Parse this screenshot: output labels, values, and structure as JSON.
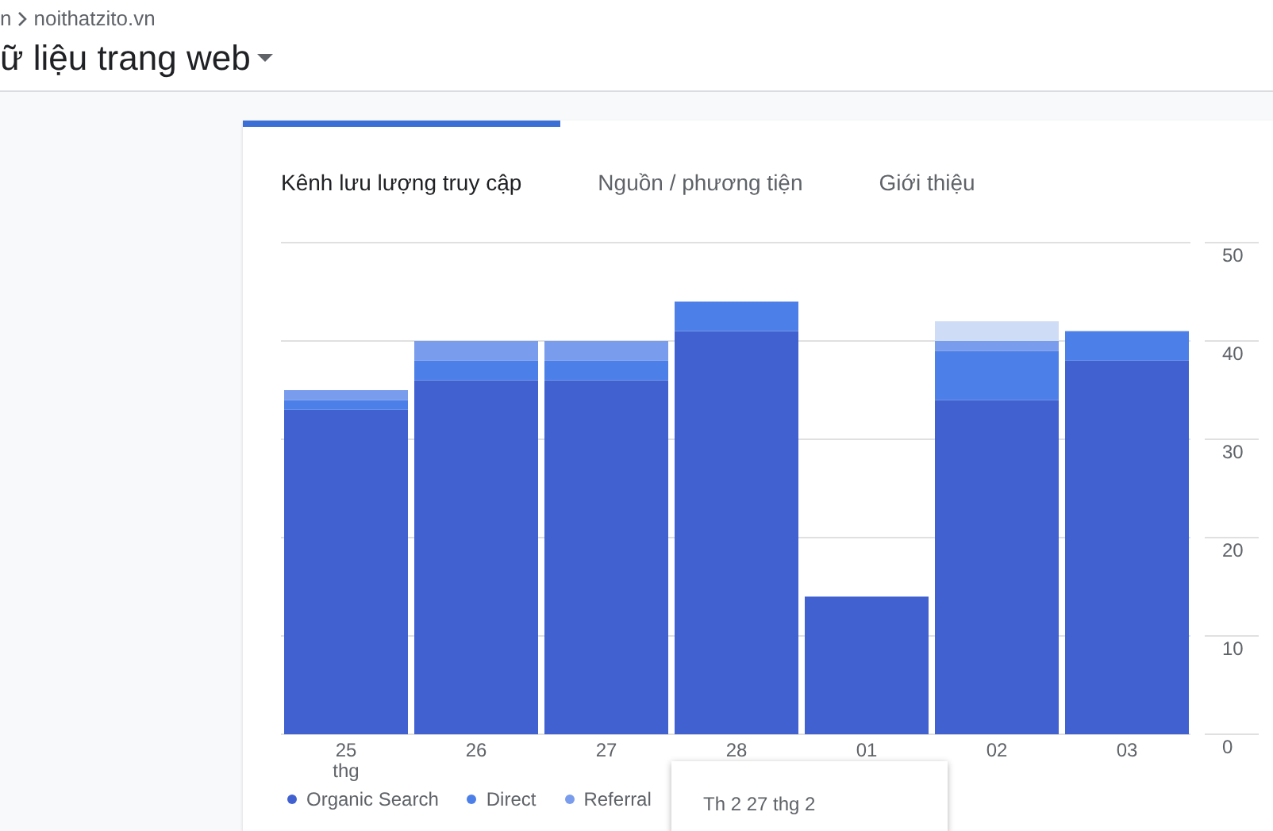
{
  "breadcrumb": [
    "n",
    "noithatzito.vn"
  ],
  "title": "ữ liệu trang web",
  "tabs": [
    {
      "label": "Kênh lưu lượng truy cập",
      "selected": true
    },
    {
      "label": "Nguồn / phương tiện",
      "selected": false
    },
    {
      "label": "Giới thiệu",
      "selected": false
    }
  ],
  "chart_data": {
    "type": "bar",
    "stacked": true,
    "grid": true,
    "categories": [
      "25 thg",
      "26",
      "27",
      "28",
      "01",
      "02",
      "03"
    ],
    "ylim": [
      0,
      50
    ],
    "yticks": [
      0,
      10,
      20,
      30,
      40,
      50
    ],
    "series": [
      {
        "name": "Organic Search",
        "color": "#4161d1",
        "values": [
          33,
          36,
          36,
          41,
          14,
          34,
          38
        ]
      },
      {
        "name": "Direct",
        "color": "#4d7fe8",
        "values": [
          1,
          2,
          2,
          3,
          0,
          5,
          3
        ]
      },
      {
        "name": "Referral",
        "color": "#7a9cec",
        "values": [
          1,
          2,
          2,
          0,
          0,
          1,
          0
        ]
      },
      {
        "color": "#cfdcf5",
        "values": [
          0,
          0,
          0,
          0,
          0,
          2,
          0
        ]
      }
    ]
  },
  "tooltip": {
    "text": "Th 2 27 thg 2"
  }
}
